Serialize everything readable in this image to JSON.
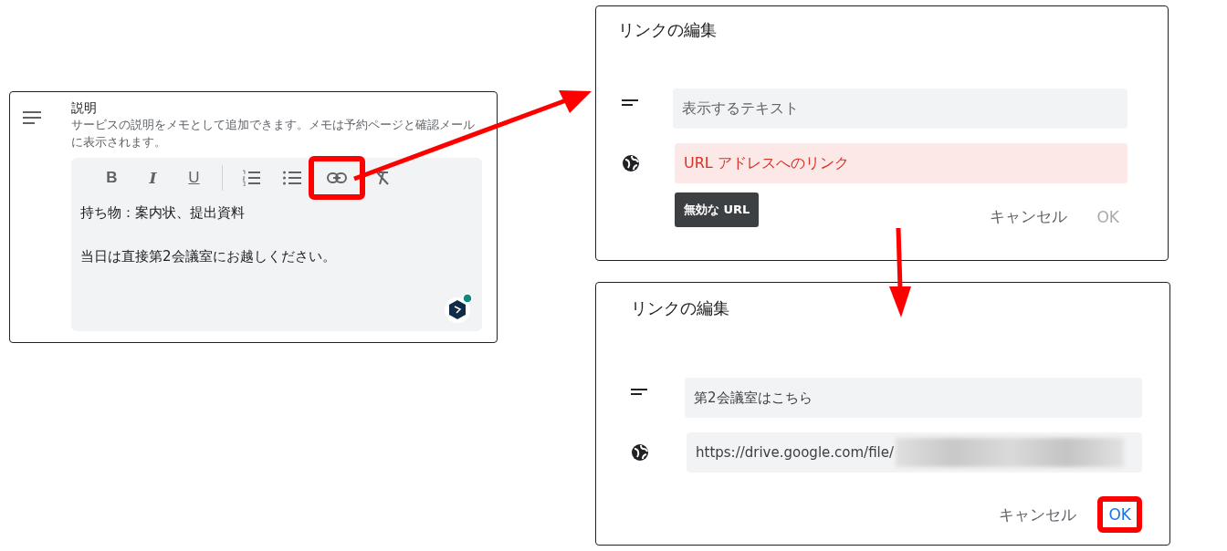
{
  "description_panel": {
    "title": "説明",
    "help": "サービスの説明をメモとして追加できます。メモは予約ページと確認メールに表示されます。",
    "toolbar": [
      {
        "kind": "bold",
        "glyph": "B",
        "annotated": false
      },
      {
        "kind": "italic",
        "glyph": "I",
        "annotated": false
      },
      {
        "kind": "underline",
        "glyph": "U",
        "annotated": false
      },
      {
        "kind": "divider"
      },
      {
        "kind": "numbered-list",
        "annotated": false
      },
      {
        "kind": "bulleted-list",
        "annotated": false
      },
      {
        "kind": "link",
        "annotated": true
      },
      {
        "kind": "clear-format",
        "annotated": false
      }
    ],
    "lines": [
      "持ち物：案内状、提出資料",
      "当日は直接第2会議室にお越しください。"
    ]
  },
  "dialogs": [
    {
      "title": "リンクの編集",
      "text_field": {
        "placeholder": "表示するテキスト"
      },
      "url_field": {
        "placeholder": "URL アドレスへのリンク",
        "error": true
      },
      "tooltip": "無効な URL",
      "buttons": [
        {
          "label": "キャンセル",
          "kind": "cancel",
          "disabled": false,
          "annotated": false
        },
        {
          "label": "OK",
          "kind": "ok",
          "disabled": true,
          "annotated": false
        }
      ]
    },
    {
      "title": "リンクの編集",
      "text_field": {
        "value": "第2会議室はこちら"
      },
      "url_field": {
        "value": "https://drive.google.com/file/",
        "error": false,
        "redacted": true
      },
      "buttons": [
        {
          "label": "キャンセル",
          "kind": "cancel",
          "disabled": false,
          "annotated": false
        },
        {
          "label": "OK",
          "kind": "ok",
          "disabled": false,
          "annotated": true
        }
      ]
    }
  ]
}
